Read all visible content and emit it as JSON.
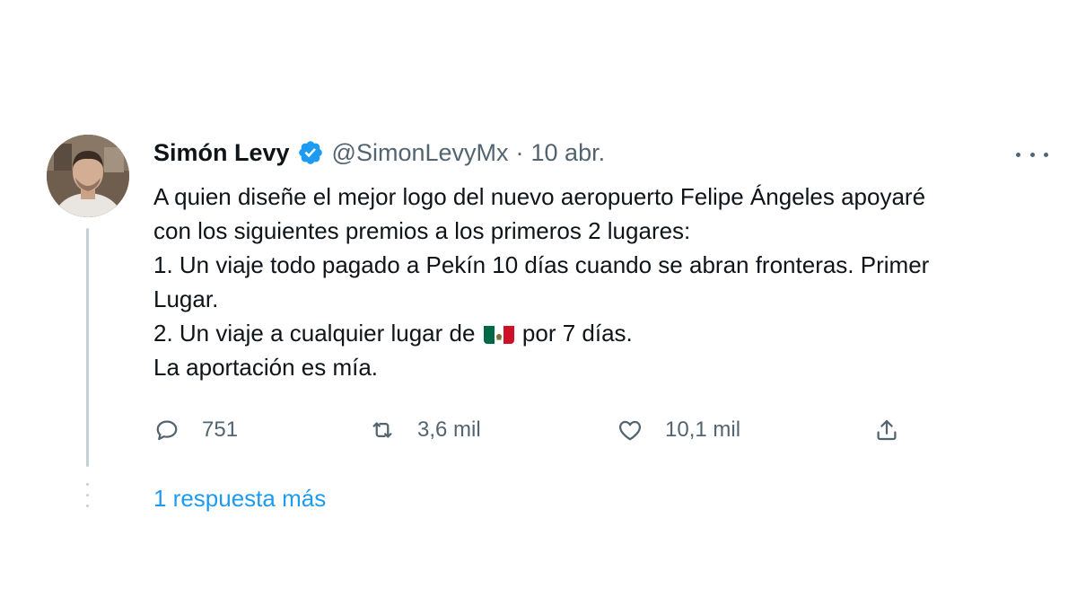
{
  "tweet": {
    "display_name": "Simón Levy",
    "handle": "@SimonLevyMx",
    "separator": "·",
    "date": "10 abr.",
    "verified_icon": "verified-badge-icon",
    "more_icon": "more-icon",
    "body": {
      "line1": "A quien diseñe el mejor logo del nuevo aeropuerto Felipe Ángeles  apoyaré",
      "line2": "con los siguientes premios a los primeros 2 lugares:",
      "line3": "1. Un viaje todo pagado a Pekín 10 días cuando se abran fronteras. Primer",
      "line4": "Lugar.",
      "line5_before": "2. Un viaje a cualquier lugar de",
      "line5_after": "por 7 días.",
      "line5_emoji": "mexico-flag-icon",
      "line6": "La aportación es mía."
    },
    "actions": {
      "reply": {
        "icon": "reply-icon",
        "count": "751"
      },
      "retweet": {
        "icon": "retweet-icon",
        "count": "3,6 mil"
      },
      "like": {
        "icon": "like-icon",
        "count": "10,1 mil"
      },
      "share": {
        "icon": "share-icon"
      }
    },
    "more_replies_link": "1 respuesta más"
  },
  "colors": {
    "text": "#0f1419",
    "secondary": "#536471",
    "accent": "#1d9bf0",
    "thread_line": "#c4cfd6",
    "flag_green": "#006847",
    "flag_red": "#ce1126"
  }
}
